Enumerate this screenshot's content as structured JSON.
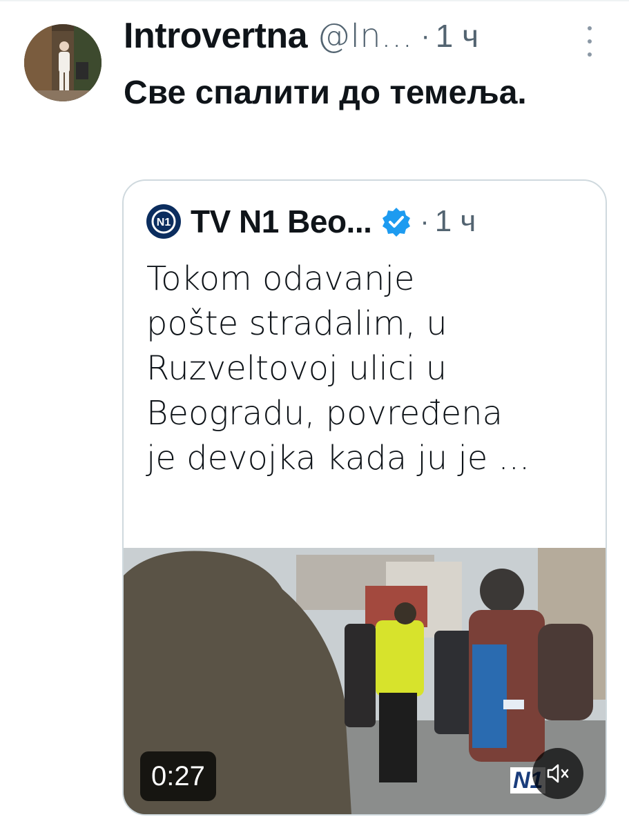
{
  "tweet": {
    "display_name": "Introvertna",
    "handle": "@In...",
    "separator": "·",
    "time": "1 ч",
    "text": "Све спалити до темеља.",
    "more_icon": "more-vertical-icon"
  },
  "quote": {
    "author_name": "TV N1 Beo...",
    "logo_icon": "n1-logo-icon",
    "verified_icon": "verified-badge-icon",
    "separator": "·",
    "time": "1 ч",
    "text": "Tokom odavanje\npošte stradalim, u\nRuzveltovoj ulici u\nBeogradu, povređena\nje devojka kada ju je ..."
  },
  "video": {
    "duration": "0:27",
    "watermark": "N1",
    "mute_icon": "volume-muted-icon"
  },
  "colors": {
    "text_primary": "#0f1419",
    "text_secondary": "#536471",
    "border": "#cfd9de",
    "verified_blue": "#1d9bf0"
  }
}
